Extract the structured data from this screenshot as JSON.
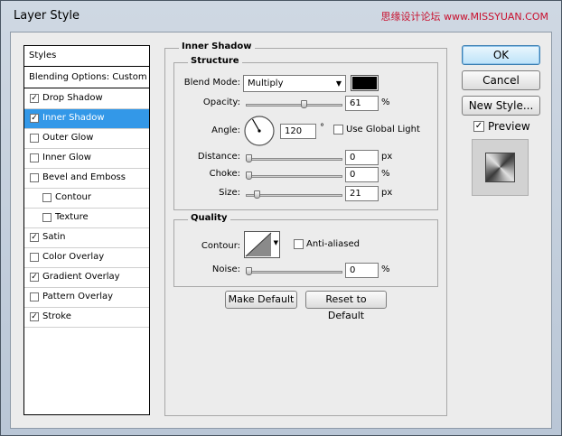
{
  "window": {
    "title": "Layer Style",
    "watermark": "思缘设计论坛 www.MISSYUAN.COM"
  },
  "styles_list": {
    "header": "Styles",
    "blending": "Blending Options: Custom",
    "items": [
      {
        "label": "Drop Shadow",
        "checked": true,
        "indent": false
      },
      {
        "label": "Inner Shadow",
        "checked": true,
        "indent": false,
        "selected": true
      },
      {
        "label": "Outer Glow",
        "checked": false,
        "indent": false
      },
      {
        "label": "Inner Glow",
        "checked": false,
        "indent": false
      },
      {
        "label": "Bevel and Emboss",
        "checked": false,
        "indent": false
      },
      {
        "label": "Contour",
        "checked": false,
        "indent": true
      },
      {
        "label": "Texture",
        "checked": false,
        "indent": true
      },
      {
        "label": "Satin",
        "checked": true,
        "indent": false
      },
      {
        "label": "Color Overlay",
        "checked": false,
        "indent": false
      },
      {
        "label": "Gradient Overlay",
        "checked": true,
        "indent": false
      },
      {
        "label": "Pattern Overlay",
        "checked": false,
        "indent": false
      },
      {
        "label": "Stroke",
        "checked": true,
        "indent": false
      }
    ]
  },
  "inner_shadow": {
    "title": "Inner Shadow",
    "structure": {
      "title": "Structure",
      "blend_mode_label": "Blend Mode:",
      "blend_mode_value": "Multiply",
      "color": "#000000",
      "opacity_label": "Opacity:",
      "opacity_value": "61",
      "opacity_unit": "%",
      "opacity_level": 0.61,
      "angle_label": "Angle:",
      "angle_value": "120",
      "angle_unit": "°",
      "global_light_label": "Use Global Light",
      "global_light_checked": false,
      "distance_label": "Distance:",
      "distance_value": "0",
      "distance_unit": "px",
      "distance_level": 0.0,
      "choke_label": "Choke:",
      "choke_value": "0",
      "choke_unit": "%",
      "choke_level": 0.0,
      "size_label": "Size:",
      "size_value": "21",
      "size_unit": "px",
      "size_level": 0.085
    },
    "quality": {
      "title": "Quality",
      "contour_label": "Contour:",
      "anti_aliased_label": "Anti-aliased",
      "anti_aliased_checked": false,
      "noise_label": "Noise:",
      "noise_value": "0",
      "noise_unit": "%",
      "noise_level": 0.0
    },
    "make_default": "Make Default",
    "reset_default": "Reset to Default"
  },
  "buttons": {
    "ok": "OK",
    "cancel": "Cancel",
    "new_style": "New Style...",
    "preview_label": "Preview",
    "preview_checked": true
  }
}
